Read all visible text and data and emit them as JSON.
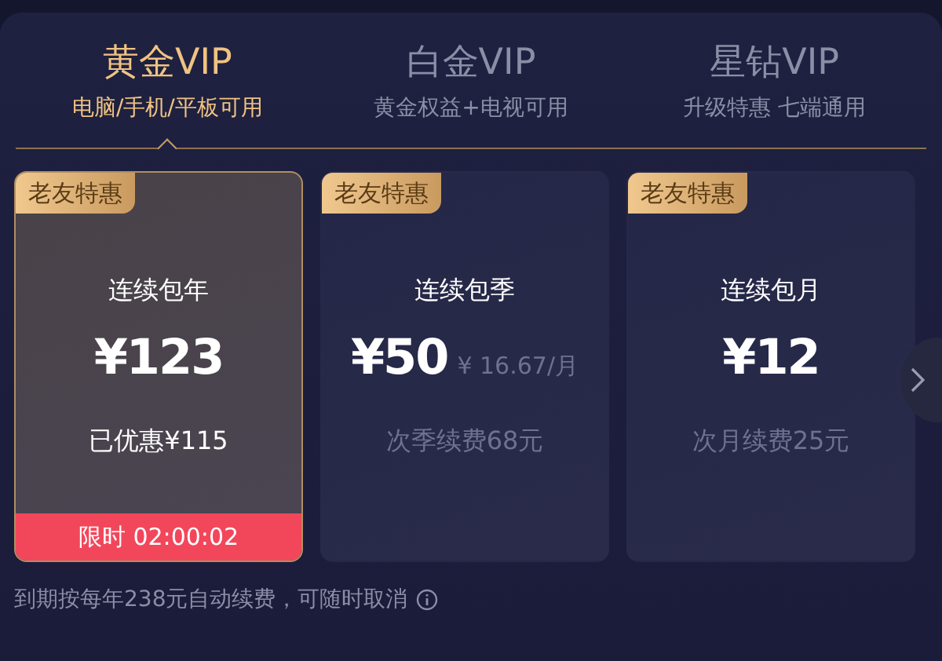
{
  "tabs": [
    {
      "title": "黄金VIP",
      "subtitle": "电脑/手机/平板可用",
      "selected": true
    },
    {
      "title": "白金VIP",
      "subtitle": "黄金权益+电视可用",
      "selected": false
    },
    {
      "title": "星钻VIP",
      "subtitle": "升级特惠 七端通用",
      "selected": false
    }
  ],
  "plans": [
    {
      "tag": "老友特惠",
      "name": "连续包年",
      "price": "¥123",
      "note": "已优惠¥115",
      "timer": "限时 02:00:02",
      "selected": true
    },
    {
      "tag": "老友特惠",
      "name": "连续包季",
      "price": "¥50",
      "per_month": "¥ 16.67/月",
      "note": "次季续费68元",
      "selected": false
    },
    {
      "tag": "老友特惠",
      "name": "连续包月",
      "price": "¥12",
      "note": "次月续费25元",
      "selected": false
    }
  ],
  "footer": {
    "text": "到期按每年238元自动续费，可随时取消"
  }
}
